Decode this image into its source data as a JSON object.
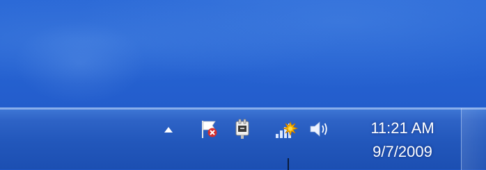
{
  "desktop": {
    "background_color": "#2663d2"
  },
  "taskbar": {
    "background_color": "#2257bb",
    "tray": {
      "icons": [
        {
          "name": "chevron-up-icon",
          "description": "show hidden icons"
        },
        {
          "name": "action-center-flag-icon",
          "status_color": "#d32f2f"
        },
        {
          "name": "power-plug-icon"
        },
        {
          "name": "network-icon",
          "status_color": "#f5b400"
        },
        {
          "name": "speaker-icon"
        }
      ]
    },
    "clock": {
      "time": "11:21 AM",
      "date": "9/7/2009"
    }
  }
}
